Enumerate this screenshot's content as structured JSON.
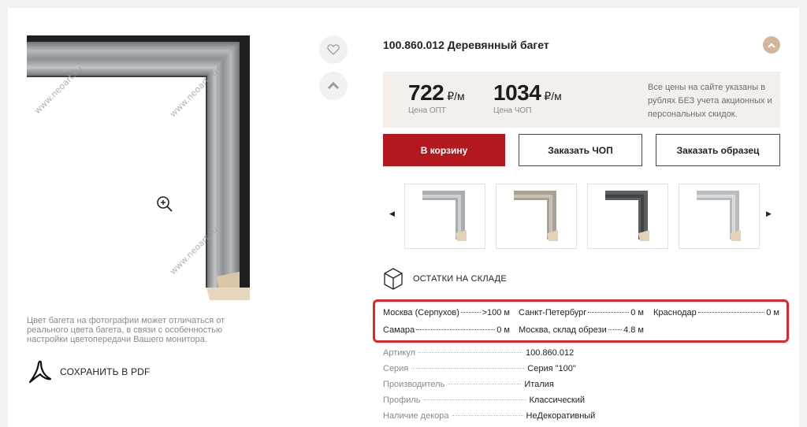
{
  "product": {
    "title": "100.860.012 Деревянный багет",
    "watermark": "www.neoart.ru",
    "photo_note": "Цвет багета на фотографии может отличаться от реального цвета багета, в связи с особенностью настройки цветопередачи Вашего монитора.",
    "save_pdf": "СОХРАНИТЬ В PDF"
  },
  "prices": {
    "opt_value": "722",
    "opt_unit": "₽/м",
    "opt_caption": "Цена ОПТ",
    "chop_value": "1034",
    "chop_unit": "₽/м",
    "chop_caption": "Цена ЧОП",
    "note": "Все цены на сайте указаны в рублях БЕЗ учета акционных и персональных скидок."
  },
  "actions": {
    "cart": "В корзину",
    "order_chop": "Заказать ЧОП",
    "order_sample": "Заказать образец"
  },
  "gallery": {
    "prev": "◀",
    "next": "▶",
    "thumbs": [
      {
        "frame": "#a9adb0",
        "inner": "#d6d8da"
      },
      {
        "frame": "#a9a294",
        "inner": "#cfc9bd"
      },
      {
        "frame": "#5b5e62",
        "inner": "#3a3c3f"
      },
      {
        "frame": "#b9bcbf",
        "inner": "#e2e3e4"
      }
    ]
  },
  "stock": {
    "heading": "ОСТАТКИ НА СКЛАДЕ",
    "items": [
      {
        "city": "Москва (Серпухов)",
        "qty": ">100 м"
      },
      {
        "city": "Санкт-Петербург",
        "qty": "0 м"
      },
      {
        "city": "Краснодар",
        "qty": "0 м"
      },
      {
        "city": "Самара",
        "qty": "0 м"
      },
      {
        "city": "Москва, склад обрези",
        "qty": "4.8 м"
      }
    ]
  },
  "specs": [
    {
      "key": "Артикул",
      "value": "100.860.012"
    },
    {
      "key": "Серия",
      "value": "Серия \"100\""
    },
    {
      "key": "Производитель",
      "value": "Италия"
    },
    {
      "key": "Профиль",
      "value": "Классический"
    },
    {
      "key": "Наличие декора",
      "value": "НеДекоративный"
    }
  ],
  "colors": {
    "accent_red": "#b3181f",
    "highlight_border": "#e0262a",
    "price_bg": "#f4efeb",
    "collapse_btn": "#d3b79d"
  }
}
